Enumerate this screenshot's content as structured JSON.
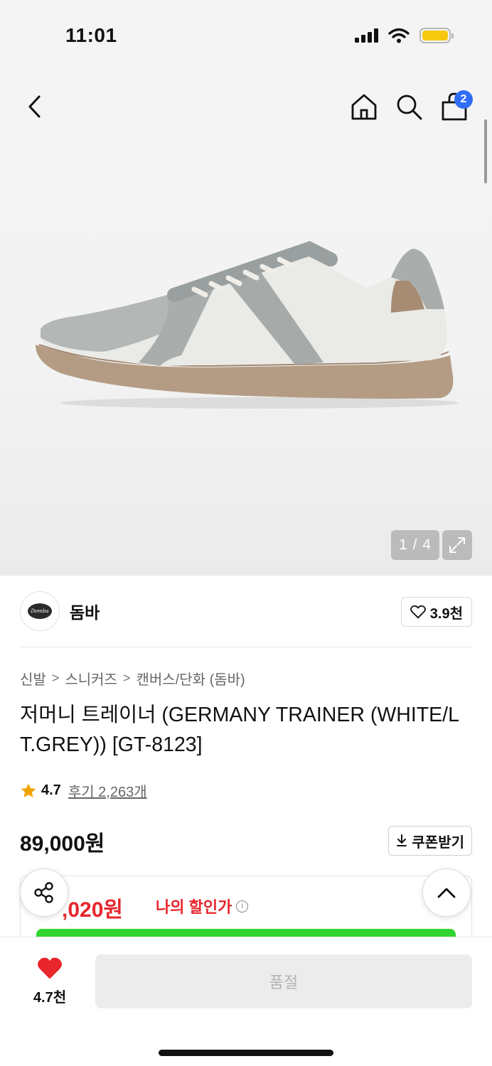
{
  "status_bar": {
    "time": "11:01"
  },
  "header": {
    "cart_count": "2"
  },
  "gallery": {
    "counter": "1 / 4"
  },
  "brand": {
    "logo_text": "Domba",
    "name": "돔바",
    "likes": "3.9천"
  },
  "breadcrumb": [
    "신발",
    "스니커즈",
    "캔버스/단화 (돔바)"
  ],
  "product": {
    "title": "저머니 트레이너 (GERMANY TRAINER (WHITE/LT.GREY)) [GT-8123]",
    "rating": "4.7",
    "review_link": "후기 2,263개",
    "price": "89,000원",
    "coupon_label": "쿠폰받기",
    "discount_price": ",020원",
    "discount_label": "나의 할인가"
  },
  "bottom_bar": {
    "wishlist_count": "4.7천",
    "purchase_label": "품절"
  },
  "colors": {
    "accent_blue": "#2f6df6",
    "discount_red": "#e8262c",
    "heart_red": "#e8262c",
    "green_bar": "#31d52f",
    "star": "#f2a300"
  }
}
